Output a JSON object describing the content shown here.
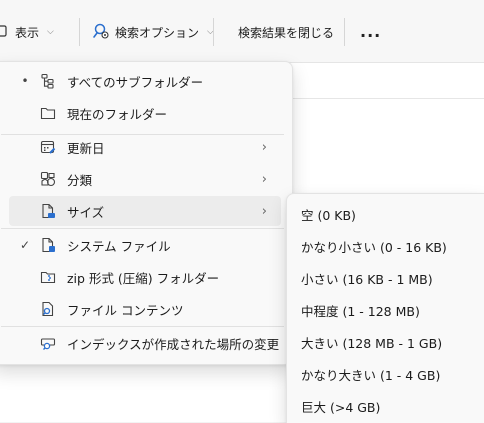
{
  "toolbar": {
    "view_label": "表示",
    "search_options_label": "検索オプション",
    "close_search_label": "検索結果を閉じる",
    "more_label": "..."
  },
  "menu": {
    "items": [
      {
        "label": "すべてのサブフォルダー",
        "icon": "subfolders-icon",
        "mark": "•"
      },
      {
        "label": "現在のフォルダー",
        "icon": "folder-icon"
      },
      {
        "label": "更新日",
        "icon": "calendar-icon",
        "submenu": true
      },
      {
        "label": "分類",
        "icon": "kind-icon",
        "submenu": true
      },
      {
        "label": "サイズ",
        "icon": "file-size-icon",
        "submenu": true,
        "highlighted": true
      },
      {
        "label": "システム ファイル",
        "icon": "system-file-icon",
        "mark": "✓"
      },
      {
        "label": "zip 形式 (圧縮) フォルダー",
        "icon": "zip-folder-icon"
      },
      {
        "label": "ファイル コンテンツ",
        "icon": "file-content-icon"
      },
      {
        "label": "インデックスが作成された場所の変更",
        "icon": "index-location-icon"
      }
    ]
  },
  "size_submenu": {
    "items": [
      {
        "label": "空 (0 KB)"
      },
      {
        "label": "かなり小さい (0 - 16 KB)"
      },
      {
        "label": "小さい (16 KB - 1 MB)"
      },
      {
        "label": "中程度 (1 - 128 MB)"
      },
      {
        "label": "大きい (128 MB - 1 GB)"
      },
      {
        "label": "かなり大きい (1 - 4 GB)"
      },
      {
        "label": "巨大 (>4 GB)"
      }
    ]
  },
  "colors": {
    "accent": "#2b6fce",
    "menu_bg": "#f9f9f9",
    "hover_bg": "#ececec"
  }
}
